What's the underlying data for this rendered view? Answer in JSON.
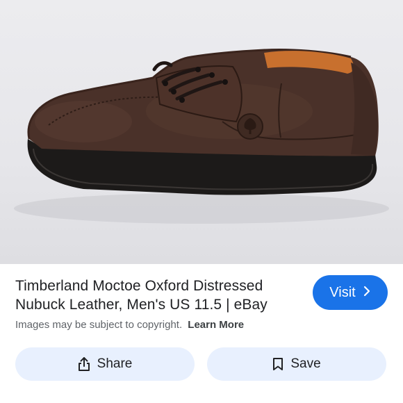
{
  "product": {
    "image_alt": "brown nubuck leather oxford shoe",
    "title_line1": "Timberland Moctoe Oxford Distressed",
    "title_line2": "Nubuck Leather, Men's US 11.5 | eBay"
  },
  "actions": {
    "visit_label": "Visit",
    "visit_icon": "chevron-right-icon",
    "share_label": "Share",
    "share_icon": "share-icon",
    "save_label": "Save",
    "save_icon": "bookmark-icon"
  },
  "notice": {
    "text": "Images may be subject to copyright.",
    "link": "Learn More"
  },
  "colors": {
    "accent": "#1a73e8",
    "pill_bg": "#e8f0fe",
    "text": "#202124",
    "muted": "#5f6368"
  }
}
